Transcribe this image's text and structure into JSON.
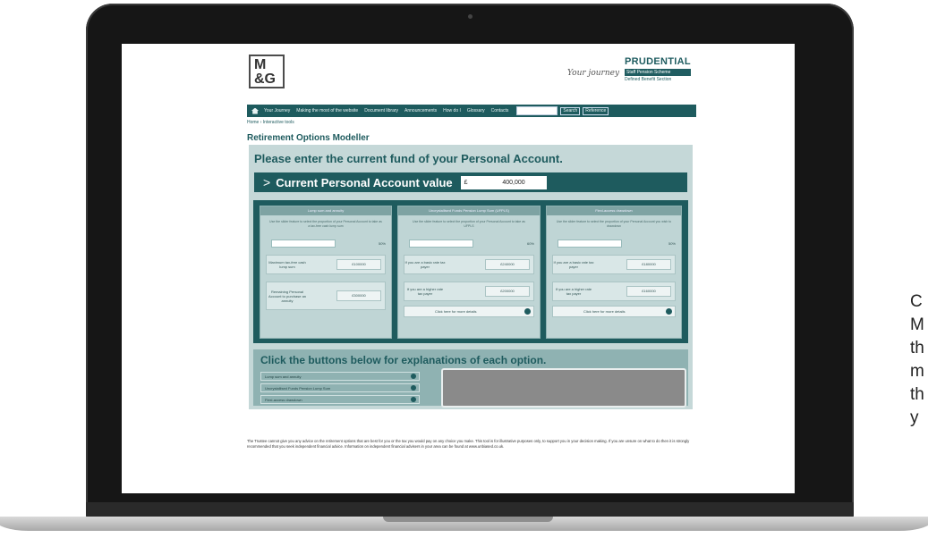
{
  "side_caption": [
    "C",
    "M",
    "th",
    "m",
    "th",
    "y"
  ],
  "header": {
    "logo_lines": [
      "M",
      "&G"
    ],
    "tagline_script": "Your journey",
    "brand": "PRUDENTIAL",
    "brand_sub1": "Staff Pension Scheme",
    "brand_sub2": "Defined Benefit Section"
  },
  "nav": {
    "items": [
      "Your Journey",
      "Making the most of the website",
      "Document library",
      "Announcements",
      "How do I",
      "Glossary",
      "Contacts"
    ],
    "search_button": "Search",
    "reset_button": "Reference"
  },
  "breadcrumb": "Home › Interactive tools",
  "page_title": "Retirement Options Modeller",
  "modeller": {
    "prompt": "Please enter the current fund of your Personal Account.",
    "value_label": "Current Personal Account value",
    "currency": "£",
    "value": "400,000",
    "cards": [
      {
        "title": "Lump sum and annuity",
        "desc": "Use the slider feature to select the proportion of your Personal Account to take as a tax-free cash lump sum",
        "pct": "50%",
        "rows": [
          {
            "label": "Maximum tax-free cash lump sum",
            "value": "£100000"
          },
          {
            "label": "Remaining Personal Account to purchase an annuity",
            "value": "£300000"
          }
        ],
        "details": ""
      },
      {
        "title": "Uncrystallised Funds Pension Lump Sum (UFPLS)",
        "desc": "Use the slider feature to select the proportion of your Personal Account to take as UFPLS",
        "pct": "60%",
        "rows": [
          {
            "label": "If you are a basic rate tax payer",
            "value": "£240000"
          },
          {
            "label": "If you are a higher rate tax payer",
            "value": "£200000"
          }
        ],
        "details": "Click here for more details"
      },
      {
        "title": "Flexi-access drawdown",
        "desc": "Use the slider feature to select the proportion of your Personal Account you wish to drawdown",
        "pct": "50%",
        "rows": [
          {
            "label": "If you are a basic rate tax payer",
            "value": "£180000"
          },
          {
            "label": "If you are a higher rate tax payer",
            "value": "£160000"
          }
        ],
        "details": "Click here for more details"
      }
    ],
    "explain_title": "Click the buttons below for explanations of each option.",
    "explain_buttons": [
      "Lump sum and annuity",
      "Uncrystallised Funds Pension Lump Sum",
      "Flexi-access drawdown"
    ]
  },
  "disclaimer": "The Trustee cannot give you any advice on the retirement options that are best for you or the tax you would pay on any choice you make. This tool is for illustrative purposes only, to support you in your decision making. If you are unsure on what to do then it is strongly recommended that you seek independent financial advice. Information on independent financial advisers in your area can be found at www.unbiased.co.uk."
}
